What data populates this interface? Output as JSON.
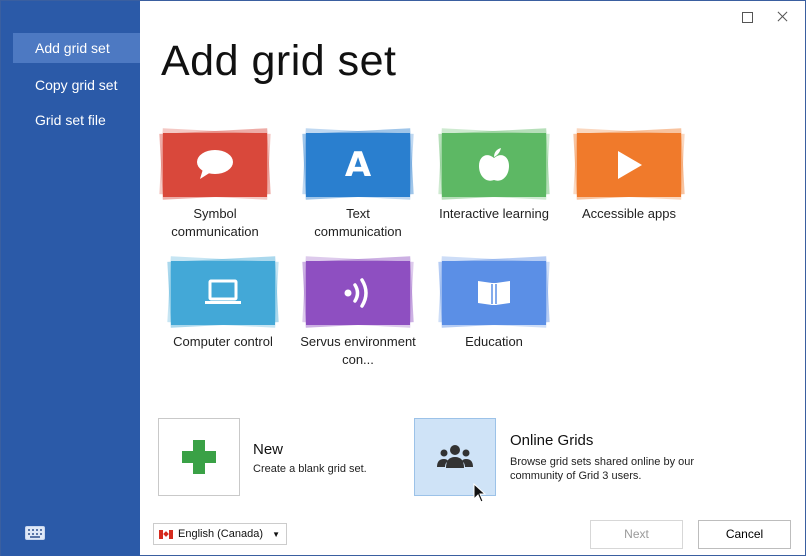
{
  "sidebar": {
    "items": [
      {
        "label": "Add grid set"
      },
      {
        "label": "Copy grid set"
      },
      {
        "label": "Grid set file"
      }
    ]
  },
  "page": {
    "title": "Add grid set"
  },
  "tiles": [
    {
      "label": "Symbol communication",
      "color": "#d9483b",
      "icon": "speech-bubble-icon"
    },
    {
      "label": "Text communication",
      "color": "#2a7fcf",
      "icon": "letter-a-icon"
    },
    {
      "label": "Interactive learning",
      "color": "#5db864",
      "icon": "apple-icon"
    },
    {
      "label": "Accessible apps",
      "color": "#f07a2b",
      "icon": "play-icon"
    },
    {
      "label": "Computer control",
      "color": "#43a8d7",
      "icon": "laptop-icon"
    },
    {
      "label": "Servus environment con...",
      "color": "#8e4fc1",
      "icon": "signal-icon"
    },
    {
      "label": "Education",
      "color": "#5b8fe6",
      "icon": "book-icon"
    }
  ],
  "new_option": {
    "title": "New",
    "description": "Create a blank grid set."
  },
  "online_option": {
    "title": "Online Grids",
    "description": "Browse grid sets shared online by our community of Grid 3 users."
  },
  "footer": {
    "language": "English (Canada)",
    "next_label": "Next",
    "cancel_label": "Cancel"
  }
}
